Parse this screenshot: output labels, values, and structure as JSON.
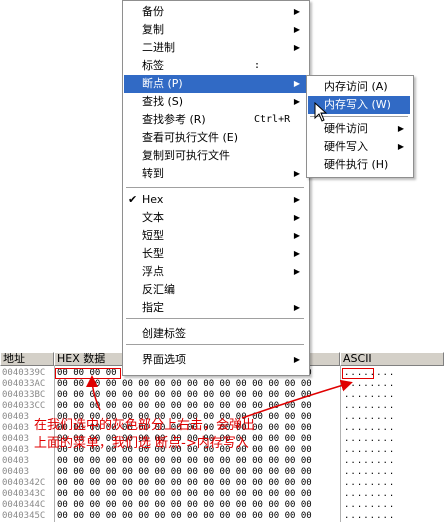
{
  "menu": {
    "items": [
      {
        "label": "备份",
        "submenu": true
      },
      {
        "label": "复制",
        "submenu": true
      },
      {
        "label": "二进制",
        "submenu": true
      },
      {
        "label": "标签",
        "shortcut": ":"
      },
      {
        "label": "断点 (P)",
        "submenu": true,
        "highlighted": true
      },
      {
        "label": "查找 (S)",
        "submenu": true
      },
      {
        "label": "查找参考 (R)",
        "shortcut": "Ctrl+R"
      },
      {
        "label": "查看可执行文件 (E)"
      },
      {
        "label": "复制到可执行文件"
      },
      {
        "label": "转到",
        "submenu": true
      },
      {
        "label": "Hex",
        "submenu": true,
        "checked": true
      },
      {
        "label": "文本",
        "submenu": true
      },
      {
        "label": "短型",
        "submenu": true
      },
      {
        "label": "长型",
        "submenu": true
      },
      {
        "label": "浮点",
        "submenu": true
      },
      {
        "label": "反汇编"
      },
      {
        "label": "指定",
        "submenu": true
      },
      {
        "label": "创建标签"
      },
      {
        "label": "界面选项",
        "submenu": true
      }
    ],
    "check_glyph": "✔",
    "arrow_glyph": "▶"
  },
  "submenu": {
    "items": [
      {
        "label": "内存访问 (A)"
      },
      {
        "label": "内存写入 (W)",
        "highlighted": true
      },
      {
        "label": "硬件访问",
        "submenu": true
      },
      {
        "label": "硬件写入",
        "submenu": true
      },
      {
        "label": "硬件执行 (H)"
      }
    ]
  },
  "dump": {
    "headers": {
      "address": "地址",
      "hex": "HEX 数据",
      "ascii": "ASCII"
    },
    "rows": [
      {
        "addr": "0040339C",
        "hex": "00 00 00 00 00 00 00 00 00 00 00 00 00 00 00 00",
        "ascii": "........"
      },
      {
        "addr": "004033AC",
        "hex": "00 00 00 00 00 00 00 00 00 00 00 00 00 00 00 00",
        "ascii": "........"
      },
      {
        "addr": "004033BC",
        "hex": "00 00 00 00 00 00 00 00 00 00 00 00 00 00 00 00",
        "ascii": "........"
      },
      {
        "addr": "004033CC",
        "hex": "00 00 00 00 00 00 00 00 00 00 00 00 00 00 00 00",
        "ascii": "........"
      },
      {
        "addr": "00403",
        "hex": "00 00 00 00 00 00 00 00 00 00 00 00 00 00 00 00",
        "ascii": "........"
      },
      {
        "addr": "00403",
        "hex": "00 00 00 00 00 00 00 00 00 00 00 00 00 00 00 00",
        "ascii": "........"
      },
      {
        "addr": "00403",
        "hex": "00 00 00 00 00 00 00 00 00 00 00 00 00 00 00 00",
        "ascii": "........"
      },
      {
        "addr": "00403",
        "hex": "00 00 00 00 00 00 00 00 00 00 00 00 00 00 00 00",
        "ascii": "........"
      },
      {
        "addr": "00403",
        "hex": "00 00 00 00 00 00 00 00 00 00 00 00 00 00 00 00",
        "ascii": "........"
      },
      {
        "addr": "00403",
        "hex": "00 00 00 00 00 00 00 00 00 00 00 00 00 00 00 00",
        "ascii": "........"
      },
      {
        "addr": "0040342C",
        "hex": "00 00 00 00 00 00 00 00 00 00 00 00 00 00 00 00",
        "ascii": "........"
      },
      {
        "addr": "0040343C",
        "hex": "00 00 00 00 00 00 00 00 00 00 00 00 00 00 00 00",
        "ascii": "........"
      },
      {
        "addr": "0040344C",
        "hex": "00 00 00 00 00 00 00 00 00 00 00 00 00 00 00 00",
        "ascii": "........"
      },
      {
        "addr": "0040345C",
        "hex": "00 00 00 00 00 00 00 00 00 00 00 00 00 00 00 00",
        "ascii": "........"
      }
    ]
  },
  "annotation": {
    "text": "在我们选中的灰色部分上右击，会弹出上面的菜单，我们选 断点->内存写入",
    "color": "#e00000"
  },
  "colors": {
    "highlight": "#316ac5",
    "annotation": "#e00000",
    "header_bg": "#d4d0c8"
  }
}
